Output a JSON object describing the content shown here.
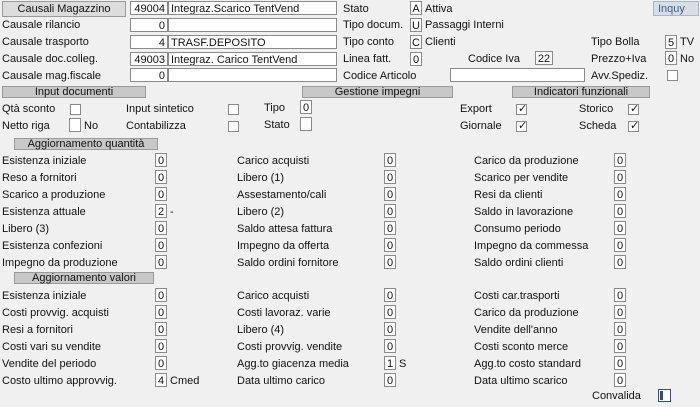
{
  "header": {
    "causali_magazzino_button": "Causali Magazzino",
    "causali_magazzino_code": "49004",
    "causali_magazzino_desc": "Integraz.Scarico TentVend",
    "inquy_label": "Inquy",
    "causale_rilancio_label": "Causale rilancio",
    "causale_rilancio_code": "0",
    "causale_rilancio_desc": "",
    "causale_trasporto_label": "Causale trasporto",
    "causale_trasporto_code": "4",
    "causale_trasporto_desc": "TRASF.DEPOSITO",
    "causale_doc_colleg_label": "Causale doc.colleg.",
    "causale_doc_colleg_code": "49003",
    "causale_doc_colleg_desc": "Integraz. Carico TentVend",
    "causale_mag_fiscale_label": "Causale mag.fiscale",
    "causale_mag_fiscale_code": "0",
    "causale_mag_fiscale_desc": "",
    "stato_label": "Stato",
    "stato_code": "A",
    "stato_desc": "Attiva",
    "tipo_docum_label": "Tipo docum.",
    "tipo_docum_code": "U",
    "tipo_docum_desc": "Passaggi Interni",
    "tipo_conto_label": "Tipo conto",
    "tipo_conto_code": "C",
    "tipo_conto_desc": "Clienti",
    "linea_fatt_label": "Linea fatt.",
    "linea_fatt_value": "0",
    "codice_iva_label": "Codice Iva",
    "codice_iva_value": "22",
    "codice_articolo_label": "Codice Articolo",
    "codice_articolo_value": "",
    "tipo_bolla_label": "Tipo Bolla",
    "tipo_bolla_code": "5",
    "tipo_bolla_desc": "TV",
    "prezzo_iva_label": "Prezzo+Iva",
    "prezzo_iva_code": "0",
    "prezzo_iva_desc": "No",
    "avv_spediz_label": "Avv.Spediz."
  },
  "groups": {
    "input_documenti": "Input documenti",
    "gestione_impegni": "Gestione impegni",
    "indicatori_funzionali": "Indicatori funzionali",
    "aggiornamento_quantita": "Aggiornamento quantità",
    "aggiornamento_valori": "Aggiornamento valori"
  },
  "input_documenti": {
    "qta_sconto": "Qtà sconto",
    "input_sintetico": "Input sintetico",
    "netto_riga": "Netto riga",
    "netto_riga_value": "No",
    "contabilizza": "Contabilizza"
  },
  "gestione_impegni": {
    "tipo_label": "Tipo",
    "tipo_value": "0",
    "stato_label": "Stato",
    "stato_value": ""
  },
  "indicatori": {
    "export": "Export",
    "storico": "Storico",
    "giornale": "Giornale",
    "scheda": "Scheda"
  },
  "quantita": {
    "col1": [
      {
        "label": "Esistenza iniziale",
        "value": "0"
      },
      {
        "label": "Reso    a fornitori",
        "value": "0"
      },
      {
        "label": "Scarico a produzione",
        "value": "0"
      },
      {
        "label": "Esistenza attuale",
        "value": "2",
        "suffix": "-"
      },
      {
        "label": "Libero (3)",
        "value": "0"
      },
      {
        "label": "Esistenza confezioni",
        "value": "0"
      },
      {
        "label": "Impegno da produzione",
        "value": "0"
      }
    ],
    "col2": [
      {
        "label": "Carico acquisti",
        "value": "0"
      },
      {
        "label": "Libero (1)",
        "value": "0"
      },
      {
        "label": "Assestamento/cali",
        "value": "0"
      },
      {
        "label": "Libero (2)",
        "value": "0"
      },
      {
        "label": "Saldo attesa fattura",
        "value": "0"
      },
      {
        "label": "Impegno da offerta",
        "value": "0"
      },
      {
        "label": "Saldo ordini fornitore",
        "value": "0"
      }
    ],
    "col3": [
      {
        "label": "Carico da produzione",
        "value": "0"
      },
      {
        "label": "Scarico per vendite",
        "value": "0"
      },
      {
        "label": "Resi  da clienti",
        "value": "0"
      },
      {
        "label": "Saldo in lavorazione",
        "value": "0"
      },
      {
        "label": "Consumo periodo",
        "value": "0"
      },
      {
        "label": "Impegno da commessa",
        "value": "0"
      },
      {
        "label": "Saldo ordini clienti",
        "value": "0"
      }
    ]
  },
  "valori": {
    "col1": [
      {
        "label": "Esistenza iniziale",
        "value": "0"
      },
      {
        "label": "Costi provvig. acquisti",
        "value": "0"
      },
      {
        "label": "Resi a fornitori",
        "value": "0"
      },
      {
        "label": "Costi vari su vendite",
        "value": "0"
      },
      {
        "label": "Vendite del periodo",
        "value": "0"
      },
      {
        "label": "Costo ultimo approvvig.",
        "value": "4",
        "suffix": "Cmed"
      }
    ],
    "col2": [
      {
        "label": "Carico acquisti",
        "value": "0"
      },
      {
        "label": "Costi lavoraz. varie",
        "value": "0"
      },
      {
        "label": "Libero (4)",
        "value": "0"
      },
      {
        "label": "Costi provvig. vendite",
        "value": "0"
      },
      {
        "label": "Agg.to giacenza media",
        "value": "1",
        "suffix": "S"
      },
      {
        "label": "Data ultimo carico",
        "value": "0"
      }
    ],
    "col3": [
      {
        "label": "Costi  car.trasporti",
        "value": "0"
      },
      {
        "label": "Carico da produzione",
        "value": "0"
      },
      {
        "label": "Vendite dell'anno",
        "value": "0"
      },
      {
        "label": "Costi sconto merce",
        "value": "0"
      },
      {
        "label": "Agg.to costo standard",
        "value": "0"
      },
      {
        "label": "Data ultimo scarico",
        "value": "0"
      }
    ]
  },
  "footer": {
    "convalida_label": "Convalida"
  }
}
